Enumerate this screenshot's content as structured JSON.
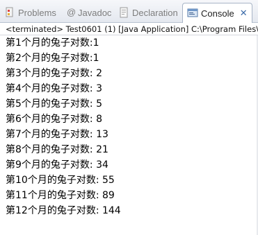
{
  "tabs": [
    {
      "label": "Problems",
      "icon": "problems-icon"
    },
    {
      "label": "Javadoc",
      "icon": "at-sign-icon"
    },
    {
      "label": "Declaration",
      "icon": "declaration-icon"
    },
    {
      "label": "Console",
      "icon": "console-icon",
      "close": "✕"
    }
  ],
  "status": "<terminated> Test0601 (1) [Java Application] C:\\Program Files\\",
  "console_lines": [
    "第1个月的兔子对数:1",
    "第2个月的兔子对数:1",
    "第3个月的兔子对数: 2",
    "第4个月的兔子对数: 3",
    "第5个月的兔子对数: 5",
    "第6个月的兔子对数: 8",
    "第7个月的兔子对数: 13",
    "第8个月的兔子对数: 21",
    "第9个月的兔子对数: 34",
    "第10个月的兔子对数: 55",
    "第11个月的兔子对数: 89",
    "第12个月的兔子对数: 144"
  ]
}
